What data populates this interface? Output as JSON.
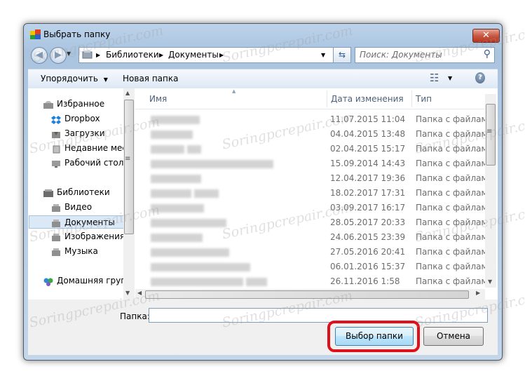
{
  "window": {
    "title": "Выбрать папку",
    "close_glyph": "✕"
  },
  "nav": {
    "back_glyph": "◀",
    "forward_glyph": "▶",
    "history_glyph": "▼"
  },
  "address": {
    "root_arrow": "▶",
    "crumb1": "Библиотеки",
    "sep1": "▶",
    "crumb2": "Документы",
    "sep2": "▶",
    "dropdown_glyph": "▼",
    "refresh_glyph": "⇆"
  },
  "search": {
    "placeholder": "Поиск: Документы",
    "icon_glyph": "⚲"
  },
  "toolbar": {
    "organize": "Упорядочить",
    "organize_arrow": "▼",
    "new_folder": "Новая папка",
    "view_glyph": "☷",
    "view_arrow": "▼",
    "help_glyph": "?"
  },
  "sidebar": {
    "favorites": "Избранное",
    "dropbox": "Dropbox",
    "downloads": "Загрузки",
    "recent": "Недавние мест",
    "desktop": "Рабочий стол",
    "libraries": "Библиотеки",
    "video": "Видео",
    "documents": "Документы",
    "images": "Изображения",
    "music": "Музыка",
    "homegroup": "Домашняя групп"
  },
  "columns": {
    "name": "Имя",
    "date": "Дата изменения",
    "type": "Тип",
    "sort_glyph": "▲"
  },
  "files": [
    {
      "date": "11.07.2015 11:04",
      "type": "Папка с файлами"
    },
    {
      "date": "04.04.2015 13:48",
      "type": "Папка с файлами"
    },
    {
      "date": "02.04.2015 15:17",
      "type": "Папка с файлами"
    },
    {
      "date": "15.09.2014 14:43",
      "type": "Папка с файлами"
    },
    {
      "date": "12.04.2017 19:36",
      "type": "Папка с файлами"
    },
    {
      "date": "18.02.2017 17:31",
      "type": "Папка с файлами"
    },
    {
      "date": "03.09.2017 16:17",
      "type": "Папка с файлами"
    },
    {
      "date": "28.05.2017 20:33",
      "type": "Папка с файлами"
    },
    {
      "date": "24.06.2015 23:39",
      "type": "Папка с файлами"
    },
    {
      "date": "27.05.2016 20:41",
      "type": "Папка с файлами"
    },
    {
      "date": "06.01.2016 15:37",
      "type": "Папка с файлами"
    },
    {
      "date": "26.11.2016 1:58",
      "type": "Папка с файлами"
    }
  ],
  "footer": {
    "folder_label": "Папка:",
    "folder_value": "",
    "select_button": "Выбор папки",
    "cancel_button": "Отмена"
  },
  "scroll": {
    "up": "▲",
    "down": "▼",
    "left": "◀",
    "right": "▶",
    "grip": "≡"
  },
  "watermark": "Soringpcrepair.com",
  "colors": {
    "highlight_ring": "#e0101a",
    "primary_button_border": "#3c7fb1",
    "close_button": "#c75945"
  }
}
